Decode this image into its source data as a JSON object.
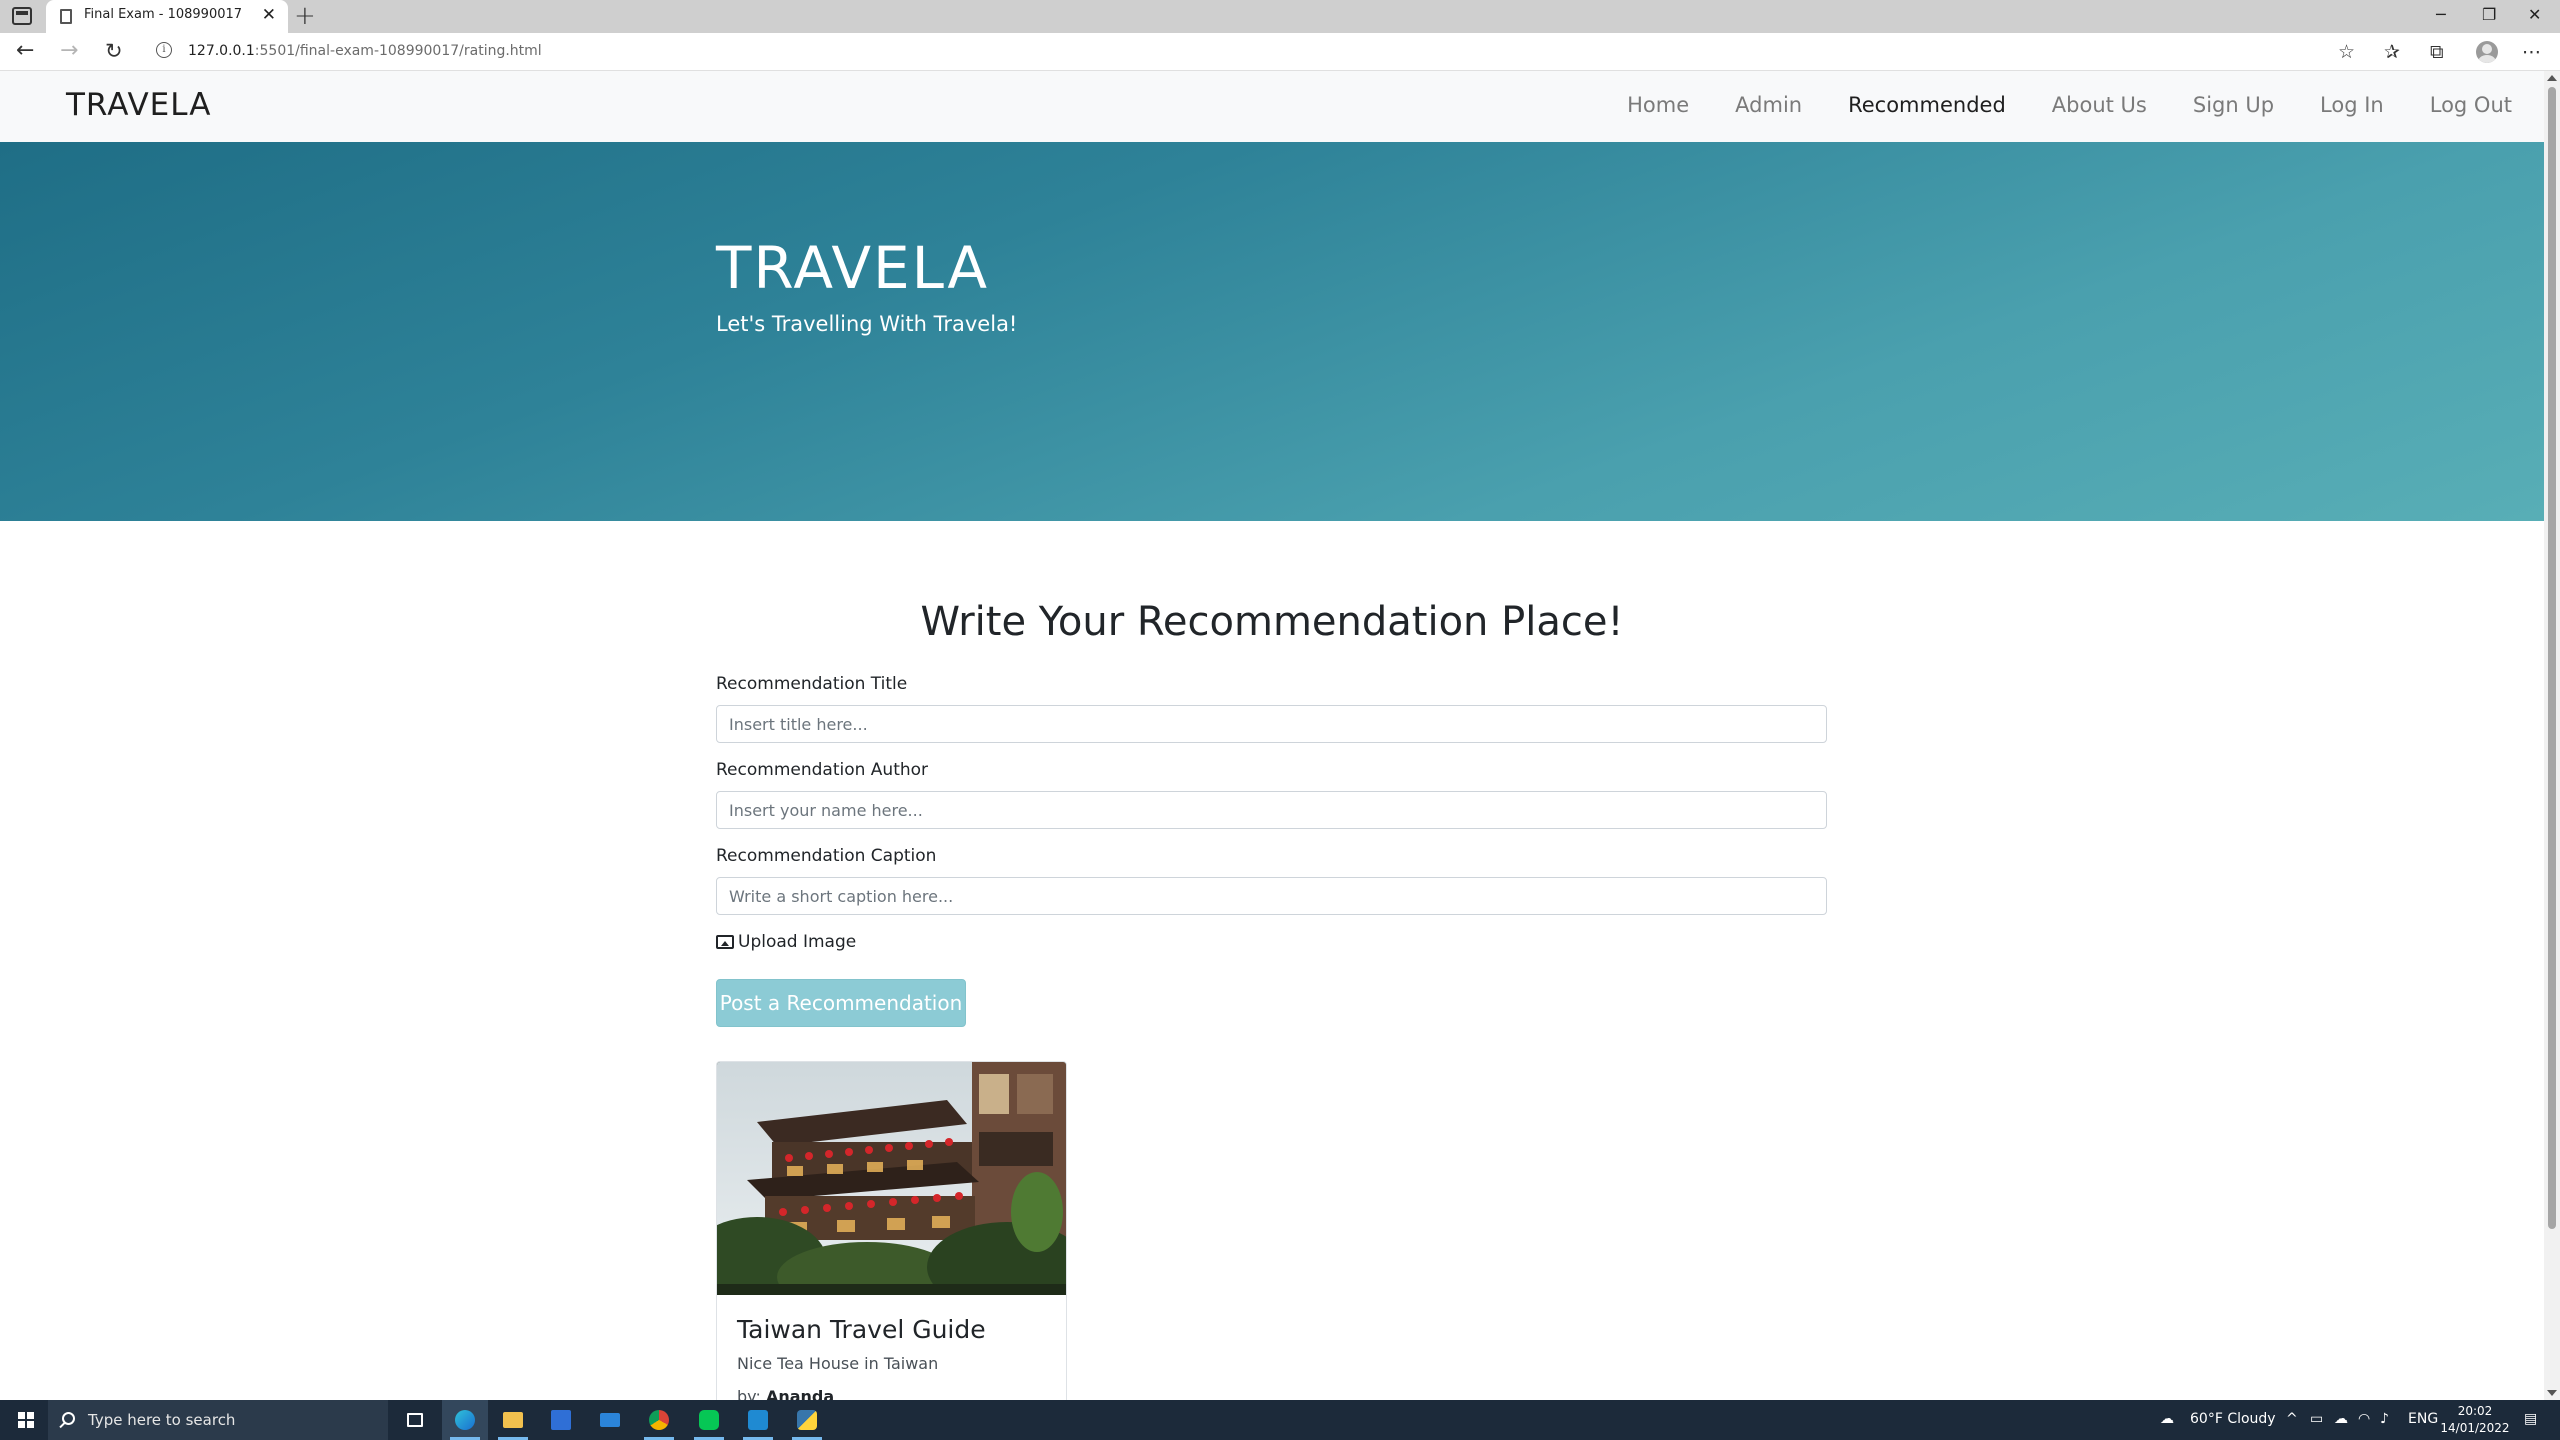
{
  "browser": {
    "tab_title": "Final Exam - 108990017",
    "tab_close": "✕",
    "new_tab": "+",
    "url_host": "127.0.0.1",
    "url_path": ":5501/final-exam-108990017/rating.html",
    "back_icon": "arrow-left-icon",
    "forward_icon": "arrow-right-icon",
    "reload_icon": "reload-icon"
  },
  "site": {
    "brand": "TRAVELA",
    "nav": [
      {
        "label": "Home",
        "active": false
      },
      {
        "label": "Admin",
        "active": false
      },
      {
        "label": "Recommended",
        "active": true
      },
      {
        "label": "About Us",
        "active": false
      },
      {
        "label": "Sign Up",
        "active": false
      },
      {
        "label": "Log In",
        "active": false
      },
      {
        "label": "Log Out",
        "active": false
      }
    ]
  },
  "hero": {
    "title": "TRAVELA",
    "subtitle": "Let's Travelling With Travela!"
  },
  "form": {
    "heading": "Write Your Recommendation Place!",
    "title_label": "Recommendation Title",
    "title_placeholder": "Insert title here...",
    "author_label": "Recommendation Author",
    "author_placeholder": "Insert your name here...",
    "caption_label": "Recommendation Caption",
    "caption_placeholder": "Write a short caption here...",
    "upload_label": "Upload Image",
    "submit_label": "Post a Recommendation"
  },
  "cards": [
    {
      "title": "Taiwan Travel Guide",
      "caption": "Nice Tea House in Taiwan",
      "author_prefix": "by:",
      "author": "Ananda"
    }
  ],
  "taskbar": {
    "search_placeholder": "Type here to search",
    "weather": "60°F  Cloudy",
    "language": "ENG",
    "time": "20:02",
    "date": "14/01/2022"
  },
  "colors": {
    "hero_gradient_start": "#1f6e86",
    "hero_gradient_end": "#58aeb6",
    "button": "#86c9d3",
    "nav_bg": "#f8f9fa"
  }
}
